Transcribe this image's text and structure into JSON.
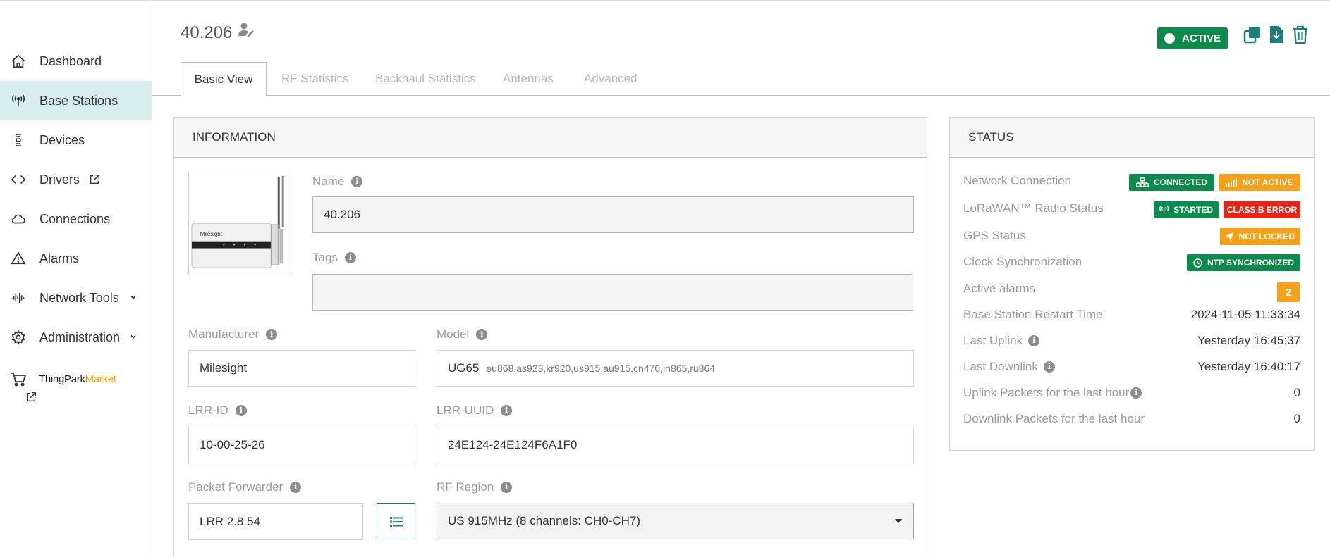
{
  "sidebar": {
    "items": [
      {
        "label": "Dashboard",
        "icon": "home-icon"
      },
      {
        "label": "Base Stations",
        "icon": "antenna-icon",
        "active": true
      },
      {
        "label": "Devices",
        "icon": "device-icon"
      },
      {
        "label": "Drivers",
        "icon": "code-icon"
      },
      {
        "label": "Connections",
        "icon": "cloud-icon"
      },
      {
        "label": "Alarms",
        "icon": "warning-icon"
      },
      {
        "label": "Network Tools",
        "icon": "waveform-icon"
      },
      {
        "label": "Administration",
        "icon": "gear-icon"
      }
    ],
    "market": {
      "part1": "ThingPark",
      "part2": "Market"
    }
  },
  "header": {
    "title": "40.206",
    "status_badge": "ACTIVE"
  },
  "tabs": [
    "Basic View",
    "RF Statistics",
    "Backhaul Statistics",
    "Antennas",
    "Advanced"
  ],
  "information": {
    "heading": "INFORMATION",
    "name_label": "Name",
    "name_value": "40.206",
    "tags_label": "Tags",
    "tags_value": "",
    "manufacturer_label": "Manufacturer",
    "manufacturer_value": "Milesight",
    "model_label": "Model",
    "model_value": "UG65",
    "model_sub": "eu868,as923,kr920,us915,au915,cn470,in865,ru864",
    "lrr_id_label": "LRR-ID",
    "lrr_id_value": "10-00-25-26",
    "lrr_uuid_label": "LRR-UUID",
    "lrr_uuid_value": "24E124-24E124F6A1F0",
    "packet_forwarder_label": "Packet Forwarder",
    "packet_forwarder_value": "LRR 2.8.54",
    "rf_region_label": "RF Region",
    "rf_region_value": "US 915MHz (8 channels: CH0-CH7)",
    "device_brand": "Milesight"
  },
  "status": {
    "heading": "STATUS",
    "network_connection_label": "Network Connection",
    "network_connected": "CONNECTED",
    "network_not_active": "NOT ACTIVE",
    "radio_label": "LoRaWAN™ Radio Status",
    "radio_started": "STARTED",
    "radio_classb": "CLASS B ERROR",
    "gps_label": "GPS Status",
    "gps_value": "NOT LOCKED",
    "clock_label": "Clock Synchronization",
    "clock_value": "NTP SYNCHRONIZED",
    "alarms_label": "Active alarms",
    "alarms_count": "2",
    "restart_label": "Base Station Restart Time",
    "restart_value": "2024-11-05 11:33:34",
    "last_uplink_label": "Last Uplink",
    "last_uplink_value": "Yesterday 16:45:37",
    "last_downlink_label": "Last Downlink",
    "last_downlink_value": "Yesterday 16:40:17",
    "uplink_packets_label": "Uplink Packets for the last hour",
    "uplink_packets_value": "0",
    "downlink_packets_label": "Downlink Packets for the last hour",
    "downlink_packets_value": "0"
  },
  "colors": {
    "accent": "#0b8a4b",
    "teal": "#1d7d7a",
    "sidebar_active": "#d8eeec",
    "warning": "#f7a11a",
    "error": "#e5241a"
  }
}
